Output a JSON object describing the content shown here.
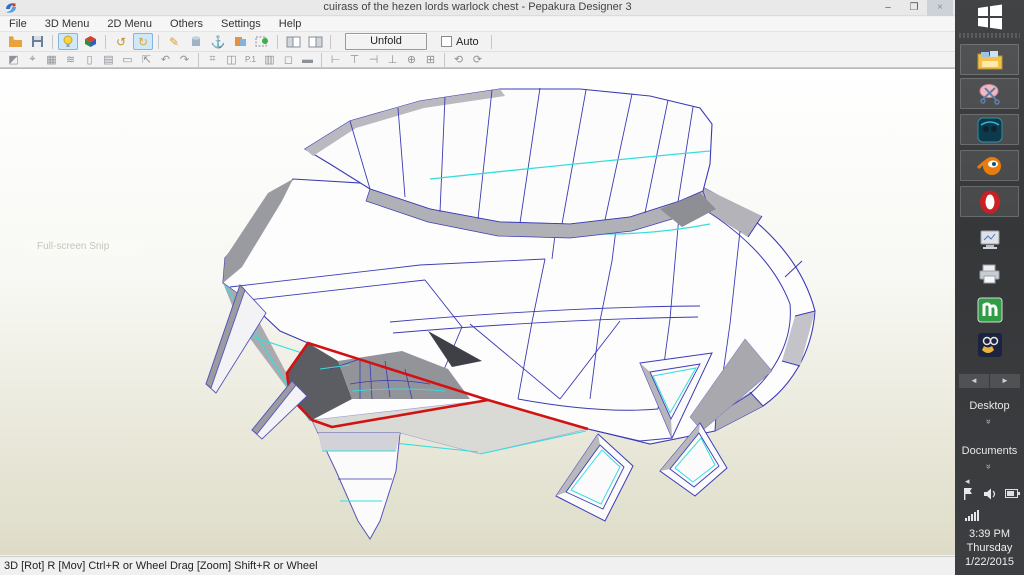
{
  "window": {
    "title": "cuirass of the hezen lords warlock chest - Pepakura Designer 3",
    "controls": {
      "minimize": "–",
      "restore": "❐",
      "close": "×"
    }
  },
  "menu_bar": {
    "items": [
      "File",
      "3D Menu",
      "2D Menu",
      "Others",
      "Settings",
      "Help"
    ]
  },
  "toolbar_main": {
    "unfold_label": "Unfold",
    "auto_label": "Auto",
    "icons": [
      "open-file",
      "save-file",
      "light-toggle-on",
      "texture-cube",
      "rotate-view",
      "rotate-view-active",
      "pencil-edit",
      "solid-view",
      "anchor",
      "material-colors",
      "select-green-sphere",
      "layout-3d-window",
      "layout-2d-window"
    ]
  },
  "toolbar_2d": {
    "icons": [
      "select-part",
      "edge-select",
      "texture-image",
      "layers",
      "glue-tabs",
      "sheet",
      "mirror",
      "move-part",
      "rotate-left",
      "rotate-right",
      "bound-box",
      "divide-face",
      "part-number",
      "stack-parts",
      "sheet-preview",
      "print-layout",
      "align-left",
      "align-top",
      "align-right",
      "align-bottom",
      "align-center-h",
      "align-distribute",
      "rotate-30",
      "rotate-90"
    ]
  },
  "viewport": {
    "ghost_text": "Full-screen Snip"
  },
  "status_bar": {
    "text": "3D [Rot] R [Mov] Ctrl+R or Wheel Drag [Zoom] Shift+R or Wheel"
  },
  "taskbar": {
    "apps": [
      "file-explorer",
      "snipping-tool",
      "media-player-app",
      "blender",
      "opera"
    ],
    "tools": [
      "display-monitor",
      "printer",
      "notepad-green-n",
      "paint-palette-app"
    ],
    "scroll": {
      "left": "◄",
      "right": "►"
    },
    "toolbars": [
      {
        "label": "Desktop"
      },
      {
        "label": "Documents"
      }
    ],
    "tray": [
      "show-hidden-icons",
      "action-center-flag",
      "volume",
      "power-battery",
      "network-signal"
    ],
    "clock": {
      "time": "3:39 PM",
      "day": "Thursday",
      "date": "1/22/2015"
    }
  },
  "colors": {
    "edge_blue": "#3b3bb5",
    "fold_cyan": "#35dede",
    "selection_red": "#d21212",
    "face_white": "#ffffff",
    "shade_gray": "#a9a9ae",
    "viewport_top": "#ffffff",
    "viewport_bottom": "#dedcc8",
    "taskbar_bg": "#3a3c3f",
    "toolbar_highlight": "#cfe8fb"
  }
}
